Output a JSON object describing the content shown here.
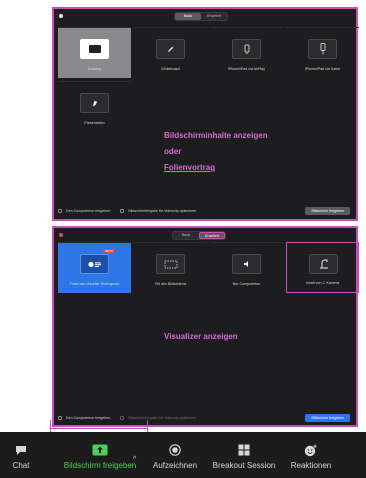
{
  "top_panel": {
    "tabs": [
      {
        "label": "Basic",
        "active": true
      },
      {
        "label": "Erweitert",
        "active": false
      }
    ],
    "options": [
      {
        "label": "Desktop",
        "icon": "desktop-icon",
        "state": "selected"
      },
      {
        "label": "Whiteboard",
        "icon": "pencil-icon",
        "state": "normal"
      },
      {
        "label": "iPhone/iPad via AirPlay",
        "icon": "iphone-icon",
        "state": "normal"
      },
      {
        "label": "iPhone/iPad via Kabel",
        "icon": "cable-icon",
        "state": "normal"
      },
      {
        "label": "Presentation",
        "icon": "keynote-icon",
        "state": "normal"
      }
    ],
    "overlay": {
      "line1": "Bildschirminhalte anzeigen",
      "line2": "oder",
      "line3": "Folienvortrag"
    },
    "footer": {
      "checkbox1": "Den Computerton freigeben",
      "checkbox2": "Bildschirmfreigabe für Videoclip optimieren",
      "button": "Bildschirm freigeben"
    }
  },
  "bottom_panel": {
    "tabs": [
      {
        "label": "Basic",
        "active": false
      },
      {
        "label": "Erweitert",
        "active": true
      }
    ],
    "options": [
      {
        "label": "Folien als virtueller Hintergrund",
        "icon": "slides-icon",
        "state": "selected",
        "badge": "BETA"
      },
      {
        "label": "Teil des Bildschirms",
        "icon": "screen-portion-icon",
        "state": "normal"
      },
      {
        "label": "Nur Computerton",
        "icon": "speaker-icon",
        "state": "normal"
      },
      {
        "label": "Inhalt von 2. Kamera",
        "icon": "camera-icon",
        "state": "outlined"
      }
    ],
    "overlay": {
      "line1": "Visualizer anzeigen"
    },
    "footer": {
      "checkbox1": "Den Computerton freigeben",
      "checkbox2": "Bildschirmfreigabe für Videoclip optimieren",
      "button": "Bildschirm freigeben"
    }
  },
  "toolbar": {
    "chat": "Chat",
    "share": "Bildschirm freigeben",
    "record": "Aufzeichnen",
    "breakout": "Breakout Session",
    "reactions": "Reaktionen"
  },
  "colors": {
    "accent": "#c84fb6",
    "share_green": "#4ccf5a",
    "select_blue": "#2d76e8"
  }
}
